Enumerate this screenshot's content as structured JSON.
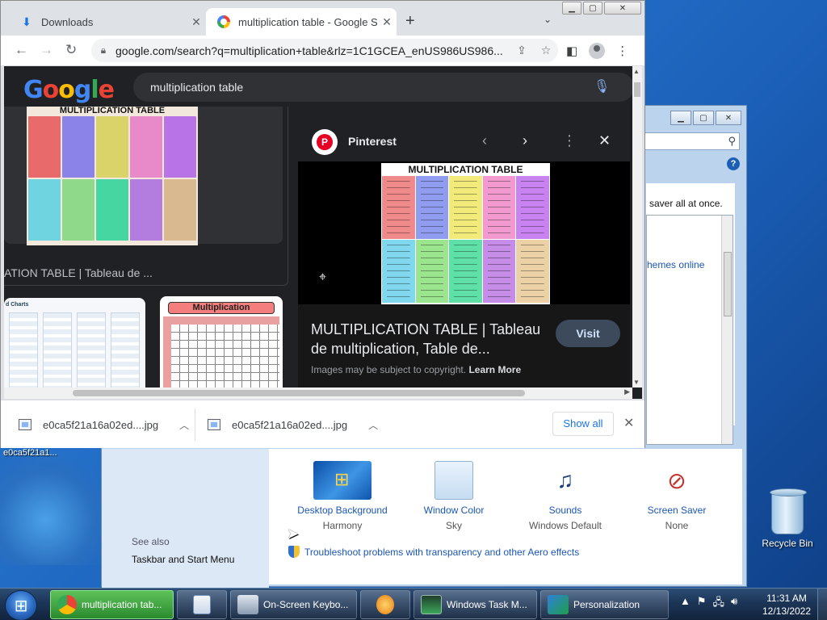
{
  "desktop": {
    "icon_label": "e0ca5f21a1...",
    "recycle_bin": "Recycle Bin"
  },
  "chrome": {
    "tabs": [
      {
        "label": "Downloads",
        "icon": "download-icon"
      },
      {
        "label": "multiplication table - Google Se",
        "icon": "google-icon"
      }
    ],
    "url": "google.com/search?q=multiplication+table&rlz=1C1GCEA_enUS986US986...",
    "search_query": "multiplication table",
    "logo": [
      "G",
      "o",
      "o",
      "g",
      "l",
      "e"
    ],
    "result_caption": "ATION TABLE | Tableau de ...",
    "thumb_small_caption": "d Charts",
    "thumb_multiplication": "Multiplication",
    "image_title": "MULTIPLICATION TABLE",
    "panel": {
      "source": "Pinterest",
      "title": "MULTIPLICATION TABLE | Tableau de multiplication, Table de...",
      "visit": "Visit",
      "copyright": "Images may be subject to copyright.",
      "learn_more": "Learn More"
    },
    "downloads": [
      {
        "name": "e0ca5f21a16a02ed....jpg"
      },
      {
        "name": "e0ca5f21a16a02ed....jpg"
      }
    ],
    "show_all": "Show all",
    "colors": {
      "cells_top": [
        "#e86a6a",
        "#8b83e8",
        "#d9d36a",
        "#e88ac9",
        "#b873e6"
      ],
      "cells_bottom": [
        "#6fd4e0",
        "#8fd98a",
        "#45d6a2",
        "#b37de0",
        "#d9b98f"
      ]
    }
  },
  "personalization": {
    "content_text": "saver all at once.",
    "link_text": "hemes online",
    "see_also": "See also",
    "taskbar_link": "Taskbar and Start Menu",
    "items": [
      {
        "label": "Desktop Background",
        "sub": "Harmony",
        "icon": "desktop-background-icon"
      },
      {
        "label": "Window Color",
        "sub": "Sky",
        "icon": "window-color-icon"
      },
      {
        "label": "Sounds",
        "sub": "Windows Default",
        "icon": "sounds-icon"
      },
      {
        "label": "Screen Saver",
        "sub": "None",
        "icon": "screen-saver-icon"
      }
    ],
    "troubleshoot": "Troubleshoot problems with transparency and other Aero effects"
  },
  "taskbar": {
    "buttons": [
      {
        "label": "multiplication tab...",
        "icon": "chrome-icon"
      },
      {
        "label": "",
        "icon": "wordpad-icon"
      },
      {
        "label": "On-Screen Keybo...",
        "icon": "keyboard-icon"
      },
      {
        "label": "",
        "icon": "media-player-icon"
      },
      {
        "label": "Windows Task M...",
        "icon": "task-manager-icon"
      },
      {
        "label": "Personalization",
        "icon": "personalization-icon"
      }
    ],
    "time": "11:31 AM",
    "date": "12/13/2022"
  }
}
